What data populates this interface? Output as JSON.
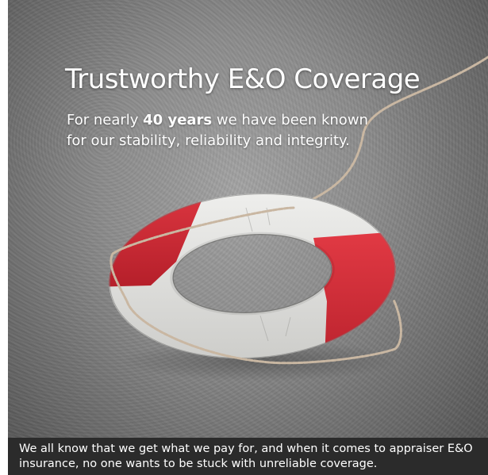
{
  "banner": {
    "headline": "Trustworthy E&O Coverage",
    "tagline": {
      "before": "For nearly ",
      "highlight": "40 years",
      "after": " we have been known",
      "line2": "for our stability, reliability and integrity."
    },
    "caption": "We all know that we get what we pay for, and when it comes to appraiser E&O insurance, no one wants to be stuck with unreliable coverage.",
    "colors": {
      "ring_red": "#d42a35",
      "ring_white": "#e8e8e6",
      "rope": "#c9b7a2",
      "background": "#8c8c8c",
      "caption_bar": "#2b2b2b"
    },
    "image": "life-ring-with-rope"
  }
}
